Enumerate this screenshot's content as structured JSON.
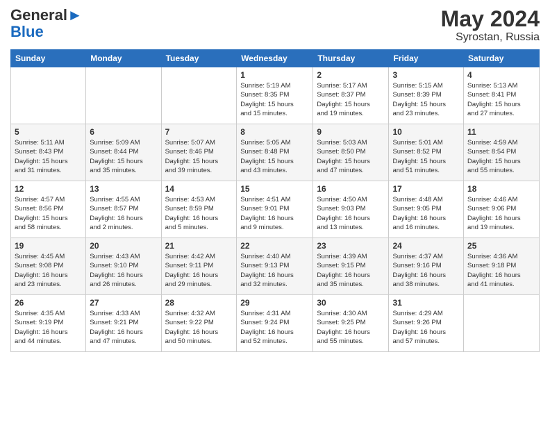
{
  "logo": {
    "general": "General",
    "blue": "Blue"
  },
  "title": "May 2024",
  "subtitle": "Syrostan, Russia",
  "days_of_week": [
    "Sunday",
    "Monday",
    "Tuesday",
    "Wednesday",
    "Thursday",
    "Friday",
    "Saturday"
  ],
  "weeks": [
    [
      {
        "day": "",
        "info": ""
      },
      {
        "day": "",
        "info": ""
      },
      {
        "day": "",
        "info": ""
      },
      {
        "day": "1",
        "info": "Sunrise: 5:19 AM\nSunset: 8:35 PM\nDaylight: 15 hours\nand 15 minutes."
      },
      {
        "day": "2",
        "info": "Sunrise: 5:17 AM\nSunset: 8:37 PM\nDaylight: 15 hours\nand 19 minutes."
      },
      {
        "day": "3",
        "info": "Sunrise: 5:15 AM\nSunset: 8:39 PM\nDaylight: 15 hours\nand 23 minutes."
      },
      {
        "day": "4",
        "info": "Sunrise: 5:13 AM\nSunset: 8:41 PM\nDaylight: 15 hours\nand 27 minutes."
      }
    ],
    [
      {
        "day": "5",
        "info": "Sunrise: 5:11 AM\nSunset: 8:43 PM\nDaylight: 15 hours\nand 31 minutes."
      },
      {
        "day": "6",
        "info": "Sunrise: 5:09 AM\nSunset: 8:44 PM\nDaylight: 15 hours\nand 35 minutes."
      },
      {
        "day": "7",
        "info": "Sunrise: 5:07 AM\nSunset: 8:46 PM\nDaylight: 15 hours\nand 39 minutes."
      },
      {
        "day": "8",
        "info": "Sunrise: 5:05 AM\nSunset: 8:48 PM\nDaylight: 15 hours\nand 43 minutes."
      },
      {
        "day": "9",
        "info": "Sunrise: 5:03 AM\nSunset: 8:50 PM\nDaylight: 15 hours\nand 47 minutes."
      },
      {
        "day": "10",
        "info": "Sunrise: 5:01 AM\nSunset: 8:52 PM\nDaylight: 15 hours\nand 51 minutes."
      },
      {
        "day": "11",
        "info": "Sunrise: 4:59 AM\nSunset: 8:54 PM\nDaylight: 15 hours\nand 55 minutes."
      }
    ],
    [
      {
        "day": "12",
        "info": "Sunrise: 4:57 AM\nSunset: 8:56 PM\nDaylight: 15 hours\nand 58 minutes."
      },
      {
        "day": "13",
        "info": "Sunrise: 4:55 AM\nSunset: 8:57 PM\nDaylight: 16 hours\nand 2 minutes."
      },
      {
        "day": "14",
        "info": "Sunrise: 4:53 AM\nSunset: 8:59 PM\nDaylight: 16 hours\nand 5 minutes."
      },
      {
        "day": "15",
        "info": "Sunrise: 4:51 AM\nSunset: 9:01 PM\nDaylight: 16 hours\nand 9 minutes."
      },
      {
        "day": "16",
        "info": "Sunrise: 4:50 AM\nSunset: 9:03 PM\nDaylight: 16 hours\nand 13 minutes."
      },
      {
        "day": "17",
        "info": "Sunrise: 4:48 AM\nSunset: 9:05 PM\nDaylight: 16 hours\nand 16 minutes."
      },
      {
        "day": "18",
        "info": "Sunrise: 4:46 AM\nSunset: 9:06 PM\nDaylight: 16 hours\nand 19 minutes."
      }
    ],
    [
      {
        "day": "19",
        "info": "Sunrise: 4:45 AM\nSunset: 9:08 PM\nDaylight: 16 hours\nand 23 minutes."
      },
      {
        "day": "20",
        "info": "Sunrise: 4:43 AM\nSunset: 9:10 PM\nDaylight: 16 hours\nand 26 minutes."
      },
      {
        "day": "21",
        "info": "Sunrise: 4:42 AM\nSunset: 9:11 PM\nDaylight: 16 hours\nand 29 minutes."
      },
      {
        "day": "22",
        "info": "Sunrise: 4:40 AM\nSunset: 9:13 PM\nDaylight: 16 hours\nand 32 minutes."
      },
      {
        "day": "23",
        "info": "Sunrise: 4:39 AM\nSunset: 9:15 PM\nDaylight: 16 hours\nand 35 minutes."
      },
      {
        "day": "24",
        "info": "Sunrise: 4:37 AM\nSunset: 9:16 PM\nDaylight: 16 hours\nand 38 minutes."
      },
      {
        "day": "25",
        "info": "Sunrise: 4:36 AM\nSunset: 9:18 PM\nDaylight: 16 hours\nand 41 minutes."
      }
    ],
    [
      {
        "day": "26",
        "info": "Sunrise: 4:35 AM\nSunset: 9:19 PM\nDaylight: 16 hours\nand 44 minutes."
      },
      {
        "day": "27",
        "info": "Sunrise: 4:33 AM\nSunset: 9:21 PM\nDaylight: 16 hours\nand 47 minutes."
      },
      {
        "day": "28",
        "info": "Sunrise: 4:32 AM\nSunset: 9:22 PM\nDaylight: 16 hours\nand 50 minutes."
      },
      {
        "day": "29",
        "info": "Sunrise: 4:31 AM\nSunset: 9:24 PM\nDaylight: 16 hours\nand 52 minutes."
      },
      {
        "day": "30",
        "info": "Sunrise: 4:30 AM\nSunset: 9:25 PM\nDaylight: 16 hours\nand 55 minutes."
      },
      {
        "day": "31",
        "info": "Sunrise: 4:29 AM\nSunset: 9:26 PM\nDaylight: 16 hours\nand 57 minutes."
      },
      {
        "day": "",
        "info": ""
      }
    ]
  ]
}
